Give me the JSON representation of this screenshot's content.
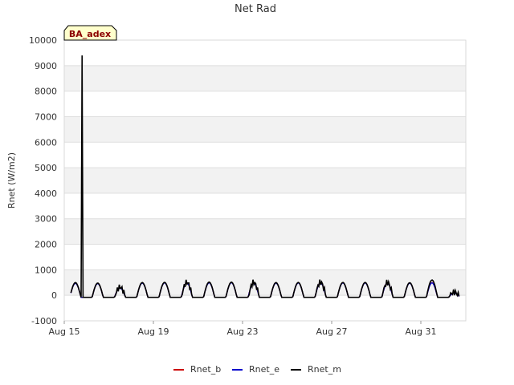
{
  "chart_data": {
    "type": "line",
    "title": "Net Rad",
    "ylabel": "Rnet (W/m2)",
    "xlabel": "",
    "site_tag": "BA_adex",
    "ylim": [
      -1000,
      10000
    ],
    "y_ticks": [
      -1000,
      0,
      1000,
      2000,
      3000,
      4000,
      5000,
      6000,
      7000,
      8000,
      9000,
      10000
    ],
    "x_day_range": [
      0,
      18
    ],
    "x_ticks": [
      {
        "label": "Aug 15",
        "day": 0
      },
      {
        "label": "Aug 19",
        "day": 4
      },
      {
        "label": "Aug 23",
        "day": 8
      },
      {
        "label": "Aug 27",
        "day": 12
      },
      {
        "label": "Aug 31",
        "day": 16
      }
    ],
    "grid": true,
    "banded_background": true,
    "legend_position": "bottom-center",
    "colors": {
      "Rnet_b": "#cc0000",
      "Rnet_e": "#0000cc",
      "Rnet_m": "#000000"
    },
    "series": [
      {
        "name": "Rnet_b",
        "days": [],
        "values": []
      },
      {
        "name": "Rnet_e",
        "days": [],
        "values": []
      },
      {
        "name": "Rnet_m",
        "days": [],
        "values": []
      }
    ],
    "daily_series": {
      "days": [
        0.5,
        1.5,
        2.5,
        3.5,
        4.5,
        5.5,
        6.5,
        7.5,
        8.5,
        9.5,
        10.5,
        11.5,
        12.5,
        13.5,
        14.5,
        15.5,
        16.5,
        17.5
      ],
      "Rnet_b_peak": [
        480,
        470,
        300,
        490,
        500,
        495,
        500,
        505,
        495,
        490,
        495,
        500,
        495,
        495,
        490,
        485,
        500,
        100
      ],
      "Rnet_e_peak": [
        470,
        460,
        290,
        480,
        490,
        485,
        490,
        495,
        485,
        480,
        485,
        490,
        485,
        485,
        480,
        475,
        490,
        90
      ],
      "Rnet_m_peak": [
        500,
        480,
        320,
        500,
        510,
        510,
        520,
        515,
        505,
        500,
        505,
        510,
        505,
        505,
        500,
        495,
        600,
        120
      ],
      "night_value": -80,
      "Rnet_m_spike": {
        "day": 0.8,
        "value": 9400
      }
    }
  }
}
